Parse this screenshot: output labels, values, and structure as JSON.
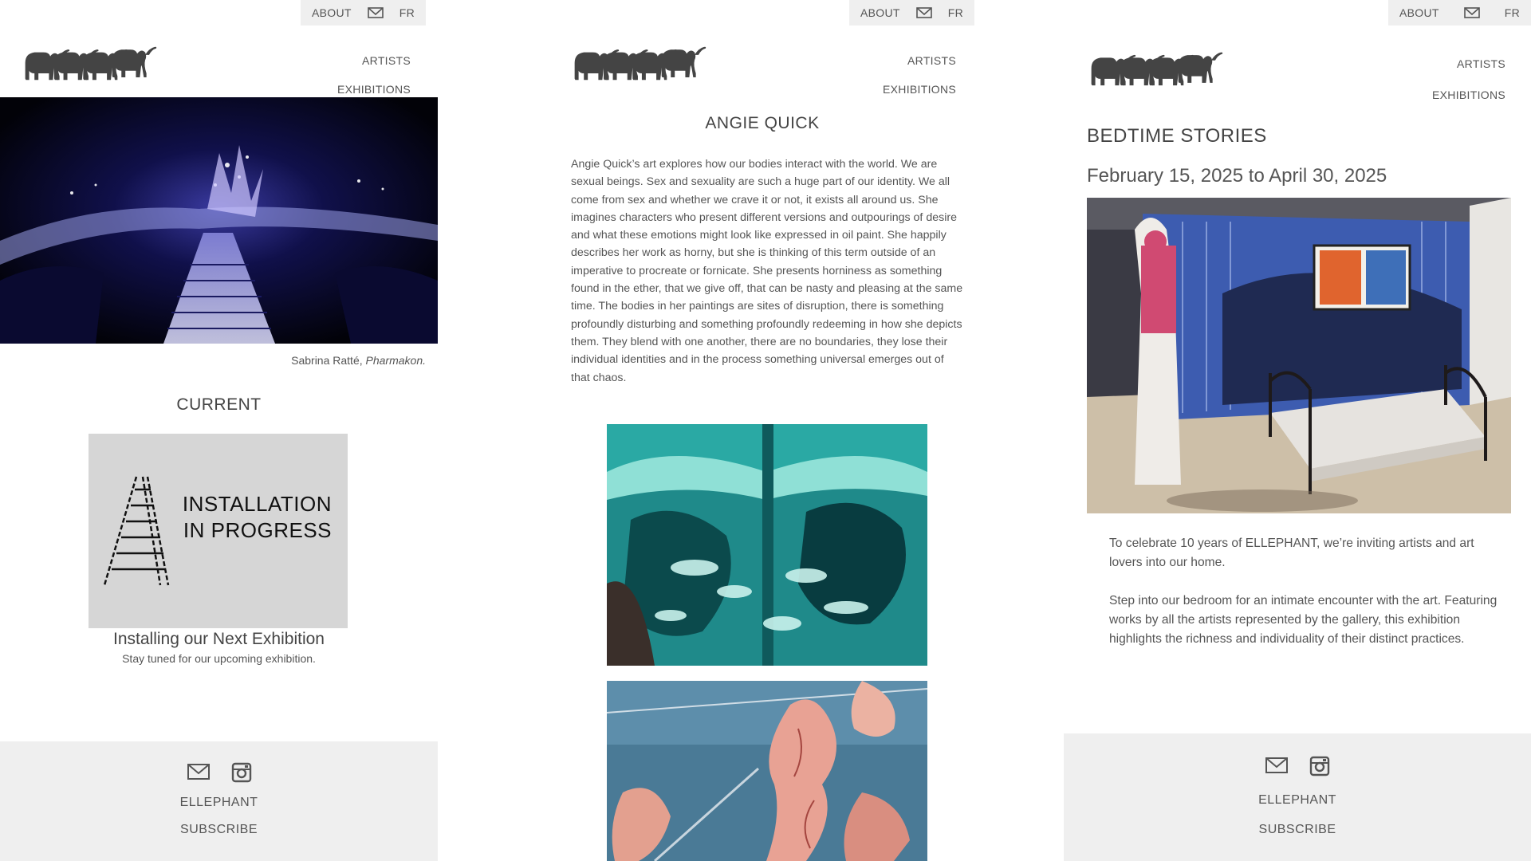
{
  "colors": {
    "topbar_bg": "#efefef",
    "footer_bg": "#efefef",
    "text": "#555555",
    "logo": "#444444"
  },
  "nav": {
    "about": "ABOUT",
    "fr": "FR",
    "artists": "ARTISTS",
    "exhibitions": "EXHIBITIONS"
  },
  "footer": {
    "name": "ELLEPHANT",
    "subscribe": "SUBSCRIBE"
  },
  "icons": [
    "elephant-logo",
    "mail-icon",
    "instagram-icon",
    "ladder-icon"
  ],
  "home": {
    "caption_artist": "Sabrina Ratté,",
    "caption_work": "Pharmakon.",
    "current_heading": "CURRENT",
    "card_line1": "INSTALLATION",
    "card_line2": "IN PROGRESS",
    "card_title": "Installing our Next Exhibition",
    "card_subtitle": "Stay tuned for our upcoming exhibition."
  },
  "artist": {
    "name": "ANGIE QUICK",
    "bio": "Angie Quick’s art explores how our bodies interact with the world. We are sexual beings. Sex and sexuality are such a huge part of our identity. We all come from sex and whether we crave it or not, it exists all around us. She imagines characters who present different versions and outpourings of desire and what these emotions might look like expressed in oil paint. She happily describes her work as horny, but she is thinking of this term outside of an imperative to procreate or fornicate. She presents horniness as something found in the ether, that we give off, that can be nasty and pleasing at the same time. The bodies in her paintings are sites of disruption, there is something profoundly disturbing and something profoundly redeeming in how she depicts them. They blend with one another, there are no boundaries, they lose their individual identities and in the process something universal emerges out of that chaos."
  },
  "exhibition": {
    "title": "BEDTIME STORIES",
    "dates": "February 15, 2025 to April 30, 2025",
    "para1": "To celebrate 10 years of ELLEPHANT, we’re inviting artists and art lovers into our home.",
    "para2": "Step into our bedroom for an intimate encounter with the art. Featuring works by all the artists represented by the gallery, this exhibition highlights the richness and individuality of their distinct practices."
  }
}
